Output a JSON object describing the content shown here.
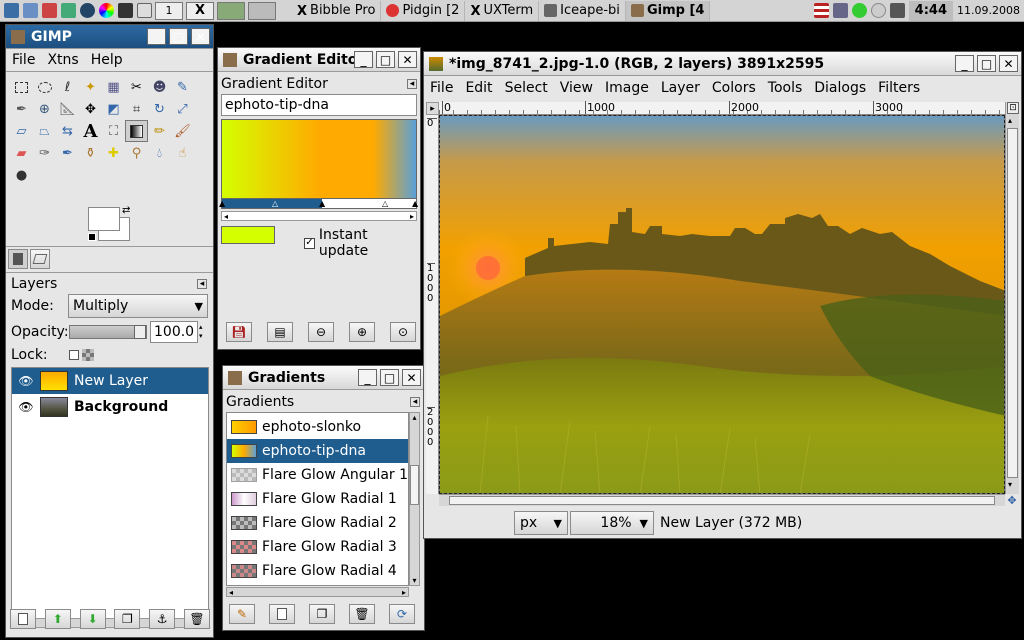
{
  "taskbar": {
    "workspace_1": "1",
    "workspace_2": "X",
    "tasks": [
      {
        "label": "Bibble Pro"
      },
      {
        "label": "Pidgin [2"
      },
      {
        "label": "UXTerm"
      },
      {
        "label": "Iceape-bi"
      },
      {
        "label": "Gimp [4"
      }
    ],
    "clock": "4:44",
    "date": "11.09.2008"
  },
  "toolbox": {
    "title": "GIMP",
    "menu": [
      "File",
      "Xtns",
      "Help"
    ],
    "layers": {
      "header": "Layers",
      "mode_label": "Mode:",
      "mode_value": "Multiply",
      "opacity_label": "Opacity:",
      "opacity_value": "100.0",
      "lock_label": "Lock:",
      "items": [
        {
          "name": "New Layer"
        },
        {
          "name": "Background"
        }
      ]
    }
  },
  "gradient_editor": {
    "title": "Gradient Edito",
    "header": "Gradient Editor",
    "gradient_name": "ephoto-tip-dna",
    "instant_update_label": "Instant update",
    "instant_update_checked": true,
    "colors": {
      "start": "#d4ff00",
      "middle": "#ffaa00",
      "end": "#5aa0d8"
    }
  },
  "gradients_dialog": {
    "title": "Gradients",
    "header": "Gradients",
    "items": [
      {
        "name": "ephoto-slonko"
      },
      {
        "name": "ephoto-tip-dna"
      },
      {
        "name": "Flare Glow Angular 1"
      },
      {
        "name": "Flare Glow Radial 1"
      },
      {
        "name": "Flare Glow Radial 2"
      },
      {
        "name": "Flare Glow Radial 3"
      },
      {
        "name": "Flare Glow Radial 4"
      }
    ],
    "selected_index": 1
  },
  "image_window": {
    "title": "*img_8741_2.jpg-1.0 (RGB, 2 layers) 3891x2595",
    "menu": [
      "File",
      "Edit",
      "Select",
      "View",
      "Image",
      "Layer",
      "Colors",
      "Tools",
      "Dialogs",
      "Filters"
    ],
    "ruler_h": [
      "0",
      "1000",
      "2000",
      "3000"
    ],
    "ruler_v": [
      "0",
      "1000",
      "2000"
    ],
    "unit": "px",
    "zoom": "18%",
    "status": "New Layer (372 MB)"
  }
}
